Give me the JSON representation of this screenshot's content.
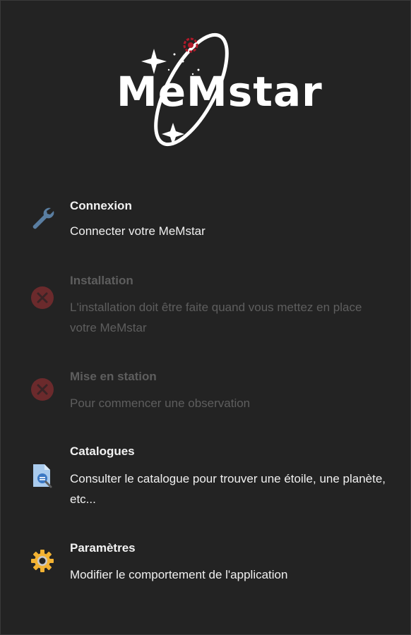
{
  "brand": {
    "name": "MeMstar"
  },
  "menu": [
    {
      "title": "Connexion",
      "description": "Connecter votre MeMstar",
      "icon": "wrench-icon",
      "enabled": true
    },
    {
      "title": "Installation",
      "description": "L'installation doit être faite quand vous mettez en place votre MeMstar",
      "icon": "error-icon",
      "enabled": false
    },
    {
      "title": "Mise en station",
      "description": "Pour commencer une observation",
      "icon": "error-icon",
      "enabled": false
    },
    {
      "title": "Catalogues",
      "description": "Consulter le catalogue pour trouver une étoile, une planète, etc...",
      "icon": "catalog-document-icon",
      "enabled": true
    },
    {
      "title": "Paramètres",
      "description": "Modifier le comportement de l'application",
      "icon": "gear-icon",
      "enabled": true
    }
  ],
  "colors": {
    "background": "#232323",
    "disabled_icon": "#6b2a2c",
    "wrench": "#5a7ea1",
    "gear": "#f2b233"
  }
}
